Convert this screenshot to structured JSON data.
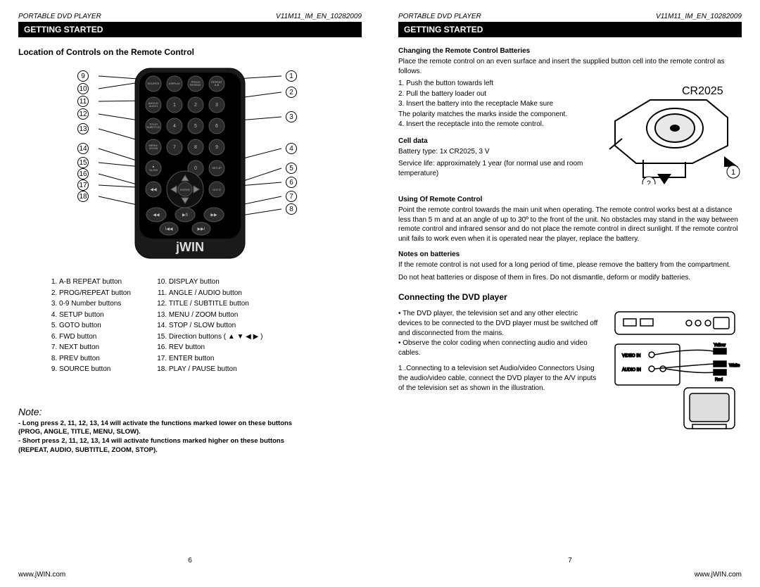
{
  "doc": {
    "product": "PORTABLE DVD PLAYER",
    "docid": "V11M11_IM_EN_10282009",
    "section": "GETTING STARTED",
    "site": "www.jWIN.com"
  },
  "left": {
    "title": "Location of Controls on the Remote Control",
    "brand": "jWIN",
    "button_rows": {
      "r1": {
        "a": "SOURCE",
        "b": "DISPLAY",
        "c": "PROG/\nREPEAT",
        "d": "REPEAT\nA-B"
      },
      "r2": {
        "a": "ANGLE/\nAUDIO",
        "b": "1",
        "c": "2",
        "d": "3"
      },
      "r3": {
        "a": "TITLE/\nSUBTITLE",
        "b": "4",
        "c": "5",
        "d": "6"
      },
      "r4": {
        "a": "MENU/\nZOOM",
        "b": "7",
        "c": "8",
        "d": "9"
      },
      "r5": {
        "a": "■\nSLOW",
        "c": "0",
        "d": "SETUP"
      },
      "r6": {
        "b": "ENTER",
        "d": "GOTO"
      }
    },
    "callouts_right": [
      "1",
      "2",
      "3",
      "4",
      "5",
      "6",
      "7",
      "8"
    ],
    "callouts_left": [
      "9",
      "10",
      "11",
      "12",
      "13",
      "14",
      "15",
      "16",
      "17",
      "18"
    ],
    "list_a": [
      "A-B REPEAT button",
      "PROG/REPEAT button",
      "0-9 Number buttons",
      "SETUP button",
      "GOTO button",
      "FWD button",
      "NEXT button",
      "PREV button",
      "SOURCE button"
    ],
    "list_b": [
      "DISPLAY button",
      "ANGLE / AUDIO button",
      "TITLE / SUBTITLE button",
      "MENU / ZOOM button",
      "STOP / SLOW button",
      "Direction buttons ( ▲  ▼  ◀  ▶ )",
      "REV button",
      "ENTER button",
      "PLAY / PAUSE button"
    ],
    "note_heading": "Note:",
    "note_line1a": "- Long press 2, 11, 12, 13, 14 will activate the functions marked lower on these buttons",
    "note_line1b": "(PROG, ANGLE, TITLE, MENU, SLOW).",
    "note_line2a": "- Short press 2, 11, 12, 13, 14 will activate functions marked higher on these buttons",
    "note_line2b": "(REPEAT, AUDIO, SUBTITLE, ZOOM, STOP).",
    "pagenum": "6"
  },
  "right": {
    "h_batt": "Changing the Remote Control Batteries",
    "batt_intro": "Place the remote control on an even surface and insert the supplied button cell into the remote control as follows.",
    "batt_label": "CR2025",
    "batt_call1": "1",
    "batt_call2": "2",
    "batt_steps": [
      "1. Push the button towards left",
      "2. Pull the battery loader out",
      "3. Insert the battery into the receptacle Make sure",
      "The polarity matches the marks inside the component.",
      "4. Insert the receptacle into the remote control."
    ],
    "h_cell": "Cell data",
    "cell_line1": "Battery type: 1x CR2025, 3 V",
    "cell_line2": "Service life: approximately 1 year (for normal use and room temperature)",
    "h_use": "Using Of Remote Control",
    "use_para": "Point the remote control towards the main unit when operating. The remote control works best at a distance less than 5 m and at an angle of up to 30º  to the front of the unit. No obstacles may stand in the way between remote control and infrared sensor and do not place the remote control in direct sunlight. If the remote control unit fails to work even when it is operated near the player, replace the battery.",
    "h_notes": "Notes on batteries",
    "notes_p1": "If the remote control is not used for a long period of time, please remove the battery from the compartment.",
    "notes_p2": "Do not heat batteries or dispose of them in fires. Do not dismantle, deform or modify batteries.",
    "h_conn": "Connecting the DVD player",
    "conn_b1": "• The DVD player, the television set and any other electric devices to be connected to the DVD player must be switched off and disconnected from the mains.",
    "conn_b2": "• Observe the color coding when connecting audio and video cables.",
    "conn_p1": "1 .Connecting to a television set Audio/video Connectors Using the audio/video cable, connect the DVD player to the A/V inputs of  the television set as shown in the illustration.",
    "conn_labels": {
      "video": "VIDEO IN",
      "audio": "AUDIO IN",
      "yellow": "Yellow",
      "red": "Red",
      "white": "White"
    },
    "pagenum": "7"
  }
}
